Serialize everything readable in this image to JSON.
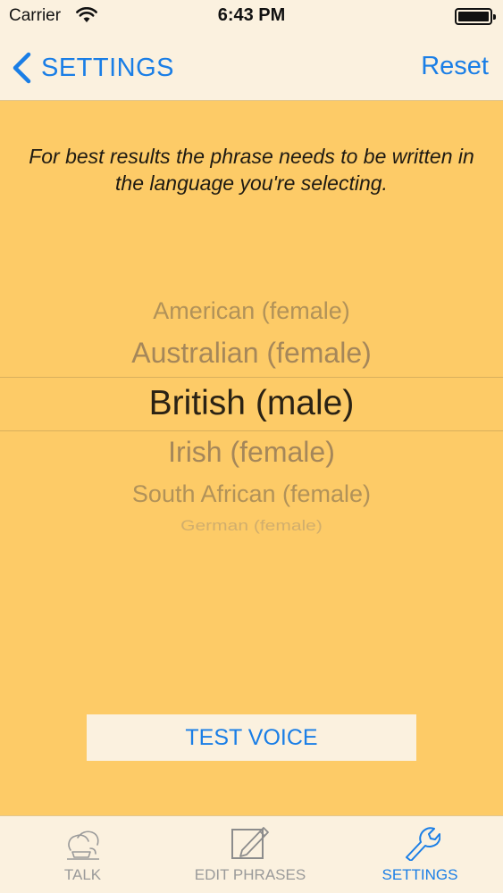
{
  "status_bar": {
    "carrier": "Carrier",
    "time": "6:43 PM"
  },
  "nav": {
    "back_label": "SETTINGS",
    "reset_label": "Reset"
  },
  "instruction": "For best results the phrase needs to be written in the language you're selecting.",
  "picker": {
    "options": [
      "American (female)",
      "Australian (female)",
      "British (male)",
      "Irish (female)",
      "South African (female)",
      "German (female)"
    ],
    "selected": "British (male)"
  },
  "test_voice_label": "TEST VOICE",
  "tabs": [
    {
      "label": "TALK",
      "icon": "talk-icon",
      "active": false
    },
    {
      "label": "EDIT PHRASES",
      "icon": "edit-phrases-icon",
      "active": false
    },
    {
      "label": "SETTINGS",
      "icon": "wrench-icon",
      "active": true
    }
  ],
  "colors": {
    "accent": "#1a7ee6",
    "background": "#fdcb67",
    "bar_background": "#fbf1df"
  }
}
